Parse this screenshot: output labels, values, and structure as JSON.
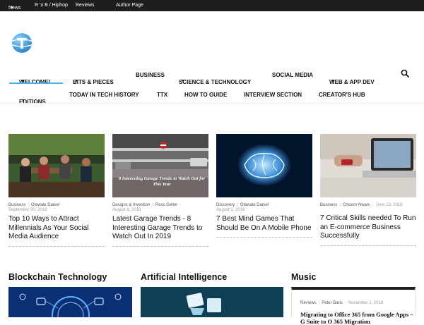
{
  "topbar": {
    "items": [
      {
        "label": "News",
        "dropdown": true
      },
      {
        "label": "R 'n B / Hiphop",
        "dropdown": false
      },
      {
        "label": "Reviews",
        "dropdown": false
      },
      {
        "label": "Author Page",
        "dropdown": false
      }
    ]
  },
  "logo": {
    "icon": "globe-t-logo-icon"
  },
  "nav": {
    "row1": [
      {
        "label": "WELCOME!",
        "dropdown": true,
        "active": true
      },
      {
        "label": "BITS & PIECES",
        "dropdown": true
      },
      {
        "label": "BUSINESS",
        "dropdown": false
      },
      {
        "label": "SCIENCE & TECHNOLOGY",
        "dropdown": true
      },
      {
        "label": "SOCIAL MEDIA",
        "dropdown": false
      },
      {
        "label": "WEB & APP DEV",
        "dropdown": true
      }
    ],
    "row2": [
      {
        "label": "Editions",
        "dropdown": true
      },
      {
        "label": "TODAY IN TECH HISTORY",
        "dropdown": false
      },
      {
        "label": "TTX",
        "dropdown": false
      },
      {
        "label": "HOW TO GUIDE",
        "dropdown": false
      },
      {
        "label": "INTERVIEW SECTION",
        "dropdown": false
      },
      {
        "label": "CREATOR'S HUB",
        "dropdown": false
      }
    ],
    "search_icon": "search-icon",
    "accent_color": "#4db2ec"
  },
  "cards": [
    {
      "category": "Business",
      "author": "Olawale Daniel",
      "date": "September 30, 2019",
      "title": "Top 10 Ways to Attract Millennials As Your Social Media Audience"
    },
    {
      "category": "Designs & Invention",
      "author": "Ross Geller",
      "date": "August 8, 2019",
      "title": "Latest Garage Trends - 8 Interesting Garage Trends to Watch Out In 2019",
      "image_caption": "8 Interesting Garage Trends to Watch Out for This Year"
    },
    {
      "category": "Discovery",
      "author": "Olawale Daniel",
      "date": "August 1, 2019",
      "title": "7 Best Mind Games That Should Be On A Mobile Phone"
    },
    {
      "category": "Business",
      "author": "Chisom Nwani",
      "date": "June 13, 2019",
      "title": "7 Critical Skills needed To Run an E-commerce Business Successfully"
    }
  ],
  "sections": {
    "blockchain": {
      "title": "Blockchain Technology"
    },
    "ai": {
      "title": "Artificial Intelligence"
    },
    "music": {
      "title": "Music",
      "category": "Reviews",
      "author": "Peter Baris",
      "date": "November 2, 2018",
      "post_title": "Migrating to Office 365 from Google Apps – G Suite to O 365 Migration"
    }
  }
}
